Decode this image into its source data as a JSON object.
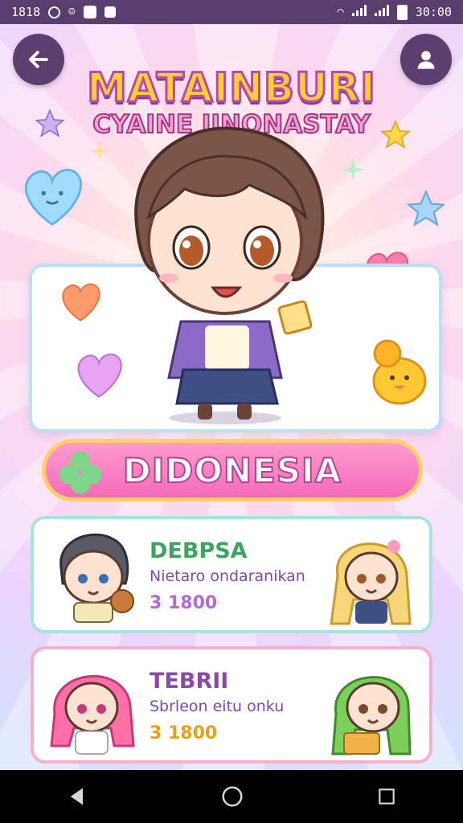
{
  "status_bar": {
    "time_left": "1818",
    "time_right": "30:00"
  },
  "header": {
    "title": "MATAINBURI",
    "subtitle": "CYAINE IINONASTAY"
  },
  "banner": {
    "label": "DIDONESIA"
  },
  "items": [
    {
      "title": "DEBPSA",
      "subtitle": "Nietaro ondaranikan",
      "price": "3 1800",
      "title_color": "#3aa55e",
      "subtitle_color": "#7a4ab0",
      "price_color": "#b66ad3"
    },
    {
      "title": "TEBRII",
      "subtitle": "Sbrleon eitu onku",
      "price": "3 1800",
      "title_color": "#8a4aa6",
      "subtitle_color": "#7a4ab0",
      "price_color": "#e6a019"
    }
  ],
  "colors": {
    "statusbar": "#5a3c6e",
    "banner": "#f46ab8",
    "accent_yellow": "#ffcf3a"
  }
}
